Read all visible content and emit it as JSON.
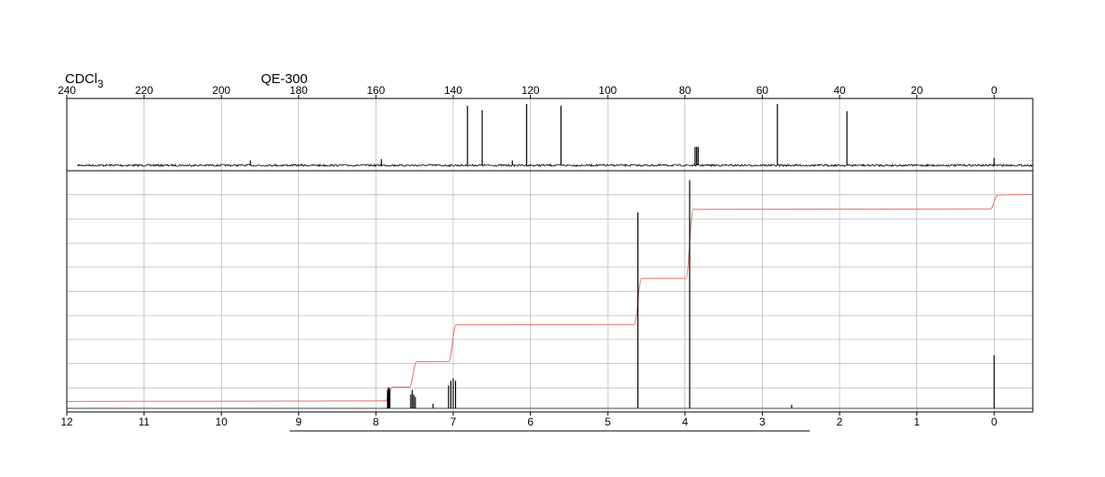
{
  "header": {
    "solvent_main": "CDCl",
    "solvent_sub": "3",
    "instrument": "QE-300"
  },
  "colors": {
    "spectrum": "#000000",
    "integral": "#e07070",
    "grid": "#9a9a9a"
  },
  "chart_data": [
    {
      "type": "line",
      "title": "",
      "xlabel": "",
      "ylabel": "",
      "xlim": [
        240,
        -10
      ],
      "xticks": [
        240,
        220,
        200,
        180,
        160,
        140,
        120,
        100,
        80,
        60,
        40,
        20,
        0
      ],
      "grid": "vertical",
      "peaks": [
        {
          "ppm": 192.5,
          "height": 0.08
        },
        {
          "ppm": 158.6,
          "height": 0.1
        },
        {
          "ppm": 136.3,
          "height": 0.97
        },
        {
          "ppm": 132.5,
          "height": 0.9
        },
        {
          "ppm": 124.7,
          "height": 0.08
        },
        {
          "ppm": 121.0,
          "height": 1.0
        },
        {
          "ppm": 112.1,
          "height": 0.97
        },
        {
          "ppm": 77.4,
          "height": 0.3
        },
        {
          "ppm": 77.0,
          "height": 0.3
        },
        {
          "ppm": 76.6,
          "height": 0.3
        },
        {
          "ppm": 56.1,
          "height": 1.0
        },
        {
          "ppm": 38.1,
          "height": 0.88
        },
        {
          "ppm": 0.0,
          "height": 0.12
        }
      ]
    },
    {
      "type": "line",
      "title": "",
      "xlabel": "",
      "ylabel": "",
      "xlim": [
        12,
        -0.5
      ],
      "xticks": [
        12,
        11,
        10,
        9,
        8,
        7,
        6,
        5,
        4,
        3,
        2,
        1,
        0
      ],
      "grid": "both",
      "peaks": [
        {
          "ppm": 7.85,
          "height": 0.08
        },
        {
          "ppm": 7.84,
          "height": 0.09
        },
        {
          "ppm": 7.83,
          "height": 0.09
        },
        {
          "ppm": 7.82,
          "height": 0.08
        },
        {
          "ppm": 7.55,
          "height": 0.06
        },
        {
          "ppm": 7.53,
          "height": 0.08
        },
        {
          "ppm": 7.51,
          "height": 0.06
        },
        {
          "ppm": 7.49,
          "height": 0.05
        },
        {
          "ppm": 7.26,
          "height": 0.02
        },
        {
          "ppm": 7.06,
          "height": 0.1
        },
        {
          "ppm": 7.03,
          "height": 0.12
        },
        {
          "ppm": 7.0,
          "height": 0.13
        },
        {
          "ppm": 6.97,
          "height": 0.12
        },
        {
          "ppm": 4.61,
          "height": 0.85
        },
        {
          "ppm": 3.94,
          "height": 0.99
        },
        {
          "ppm": 2.62,
          "height": 0.015
        },
        {
          "ppm": 0.0,
          "height": 0.23
        }
      ],
      "integral_steps": [
        {
          "ppm": 7.83,
          "rise": 0.06
        },
        {
          "ppm": 7.52,
          "rise": 0.11
        },
        {
          "ppm": 7.01,
          "rise": 0.16
        },
        {
          "ppm": 4.61,
          "rise": 0.2
        },
        {
          "ppm": 3.94,
          "rise": 0.3
        },
        {
          "ppm": 0.0,
          "rise": 0.06
        }
      ],
      "integral_base": 0.03
    }
  ]
}
